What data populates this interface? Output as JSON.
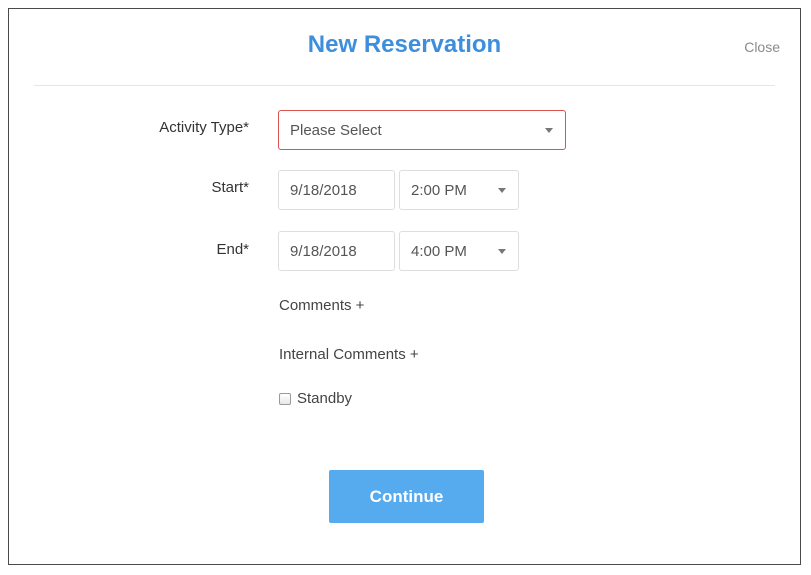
{
  "dialog": {
    "title": "New Reservation",
    "close_label": "Close"
  },
  "form": {
    "activity_type": {
      "label": "Activity Type*",
      "value": "Please Select"
    },
    "start": {
      "label": "Start*",
      "date": "9/18/2018",
      "time": "2:00 PM"
    },
    "end": {
      "label": "End*",
      "date": "9/18/2018",
      "time": "4:00 PM"
    },
    "comments_link": "Comments +",
    "internal_comments_link": "Internal Comments +",
    "standby": {
      "label": "Standby",
      "checked": false
    },
    "continue_label": "Continue"
  },
  "colors": {
    "title": "#3d8fdc",
    "button": "#56aaee",
    "invalid_border": "#d9534f"
  }
}
